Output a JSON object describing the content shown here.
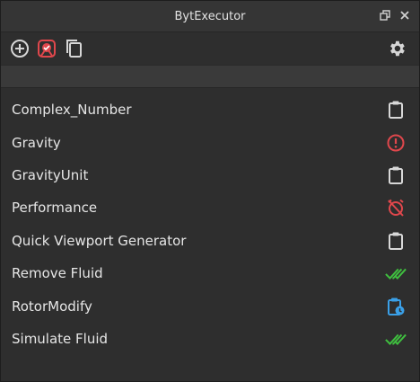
{
  "window": {
    "title": "BytExecutor"
  },
  "toolbar": {
    "buttons": [
      {
        "name": "add-script-button",
        "icon": "plus-circle-icon"
      },
      {
        "name": "run-button",
        "icon": "red-stamp-icon"
      },
      {
        "name": "copy-button",
        "icon": "copy-icon"
      }
    ],
    "settings_icon": "gear-icon"
  },
  "scripts": [
    {
      "label": "Complex_Number",
      "status": "clipboard"
    },
    {
      "label": "Gravity",
      "status": "error"
    },
    {
      "label": "GravityUnit",
      "status": "clipboard"
    },
    {
      "label": "Performance",
      "status": "alarm-off"
    },
    {
      "label": "Quick Viewport Generator",
      "status": "clipboard"
    },
    {
      "label": "Remove Fluid",
      "status": "done"
    },
    {
      "label": "RotorModify",
      "status": "clipboard-clock"
    },
    {
      "label": "Simulate Fluid",
      "status": "done"
    }
  ],
  "colors": {
    "error": "#e0474c",
    "success": "#3fbf3f",
    "info": "#3aa0e8",
    "neutral": "#d8d8d8"
  }
}
